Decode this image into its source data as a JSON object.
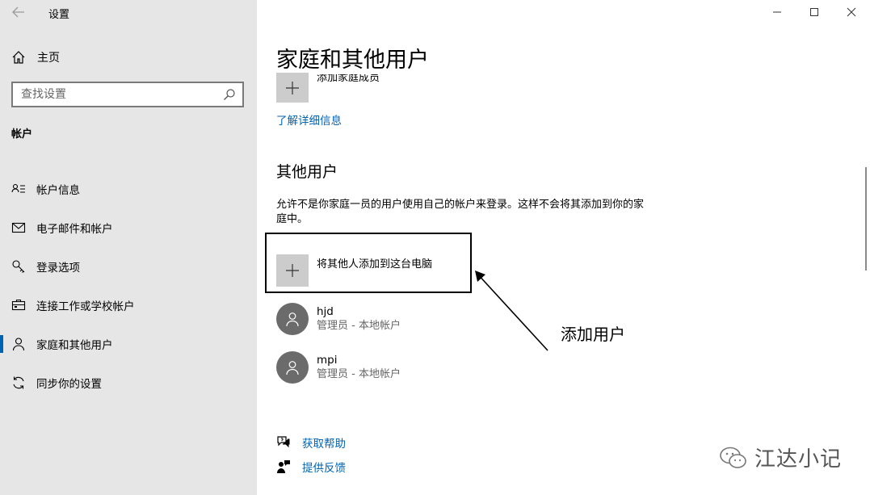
{
  "window": {
    "title": "设置"
  },
  "sidebar": {
    "home_label": "主页",
    "search_placeholder": "查找设置",
    "section_heading": "帐户",
    "items": [
      {
        "label": "帐户信息",
        "icon": "account-info-icon"
      },
      {
        "label": "电子邮件和帐户",
        "icon": "mail-icon"
      },
      {
        "label": "登录选项",
        "icon": "key-icon"
      },
      {
        "label": "连接工作或学校帐户",
        "icon": "briefcase-icon"
      },
      {
        "label": "家庭和其他用户",
        "icon": "person-icon",
        "active": true
      },
      {
        "label": "同步你的设置",
        "icon": "sync-icon"
      }
    ]
  },
  "main": {
    "page_title": "家庭和其他用户",
    "add_family_label": "添加家庭成员",
    "learn_more_link": "了解详细信息",
    "other_users_heading": "其他用户",
    "other_users_description": "允许不是你家庭一员的用户使用自己的帐户来登录。这样不会将其添加到你的家庭中。",
    "add_other_label": "将其他人添加到这台电脑",
    "users": [
      {
        "name": "hjd",
        "role": "管理员 - 本地帐户"
      },
      {
        "name": "mpi",
        "role": "管理员 - 本地帐户"
      }
    ],
    "help_link": "获取帮助",
    "feedback_link": "提供反馈"
  },
  "annotation": {
    "text": "添加用户"
  },
  "watermark": {
    "text": "江达小记"
  },
  "colors": {
    "accent": "#0063b1",
    "sidebar_bg": "#e6e6e6",
    "tile_bg": "#cccccc",
    "avatar_bg": "#6b6b6b"
  }
}
